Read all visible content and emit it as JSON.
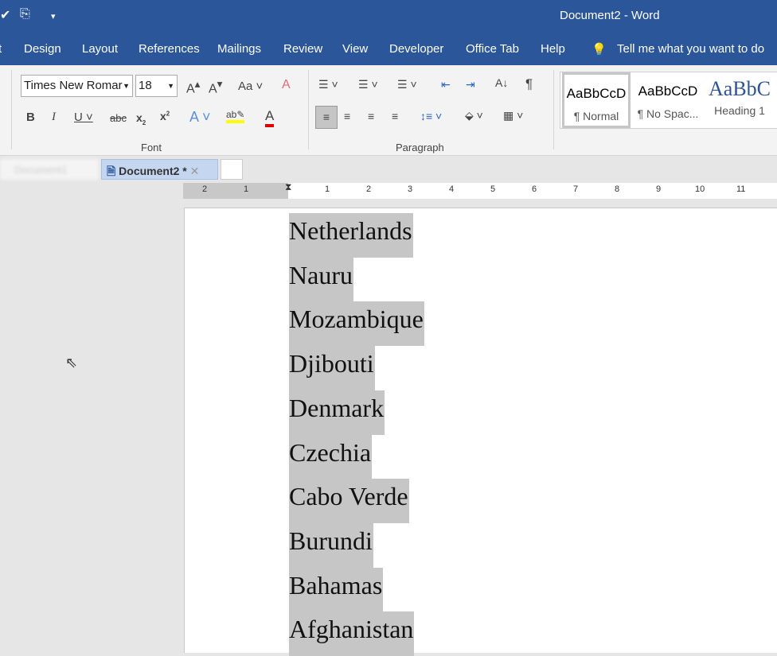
{
  "title": "Document2  -  Word",
  "menu": [
    "t",
    "Design",
    "Layout",
    "References",
    "Mailings",
    "Review",
    "View",
    "Developer",
    "Office Tab",
    "Help"
  ],
  "tell_me": "Tell me what you want to do",
  "font": {
    "name": "Times New Romar",
    "size": "18",
    "group_label": "Font"
  },
  "paragraph": {
    "group_label": "Paragraph"
  },
  "styles": [
    {
      "sample": "AaBbCcD",
      "label": "¶ Normal"
    },
    {
      "sample": "AaBbCcD",
      "label": "¶ No Spac..."
    },
    {
      "sample": "AaBbC",
      "label": "Heading 1"
    }
  ],
  "tabs": [
    {
      "label": "Document1"
    },
    {
      "label": "Document2 *"
    }
  ],
  "ruler_left": [
    "2",
    "1"
  ],
  "ruler_right": [
    "1",
    "2",
    "3",
    "4",
    "5",
    "6",
    "7",
    "8",
    "9",
    "10",
    "11"
  ],
  "colors": {
    "accent": "#2b579a",
    "highlight": "#c6c6c6",
    "heading": "#2f5496"
  },
  "document_lines": [
    "Netherlands",
    "Nauru",
    "Mozambique",
    "Djibouti",
    "Denmark",
    "Czechia",
    "Cabo Verde",
    "Burundi",
    "Bahamas",
    "Afghanistan"
  ]
}
